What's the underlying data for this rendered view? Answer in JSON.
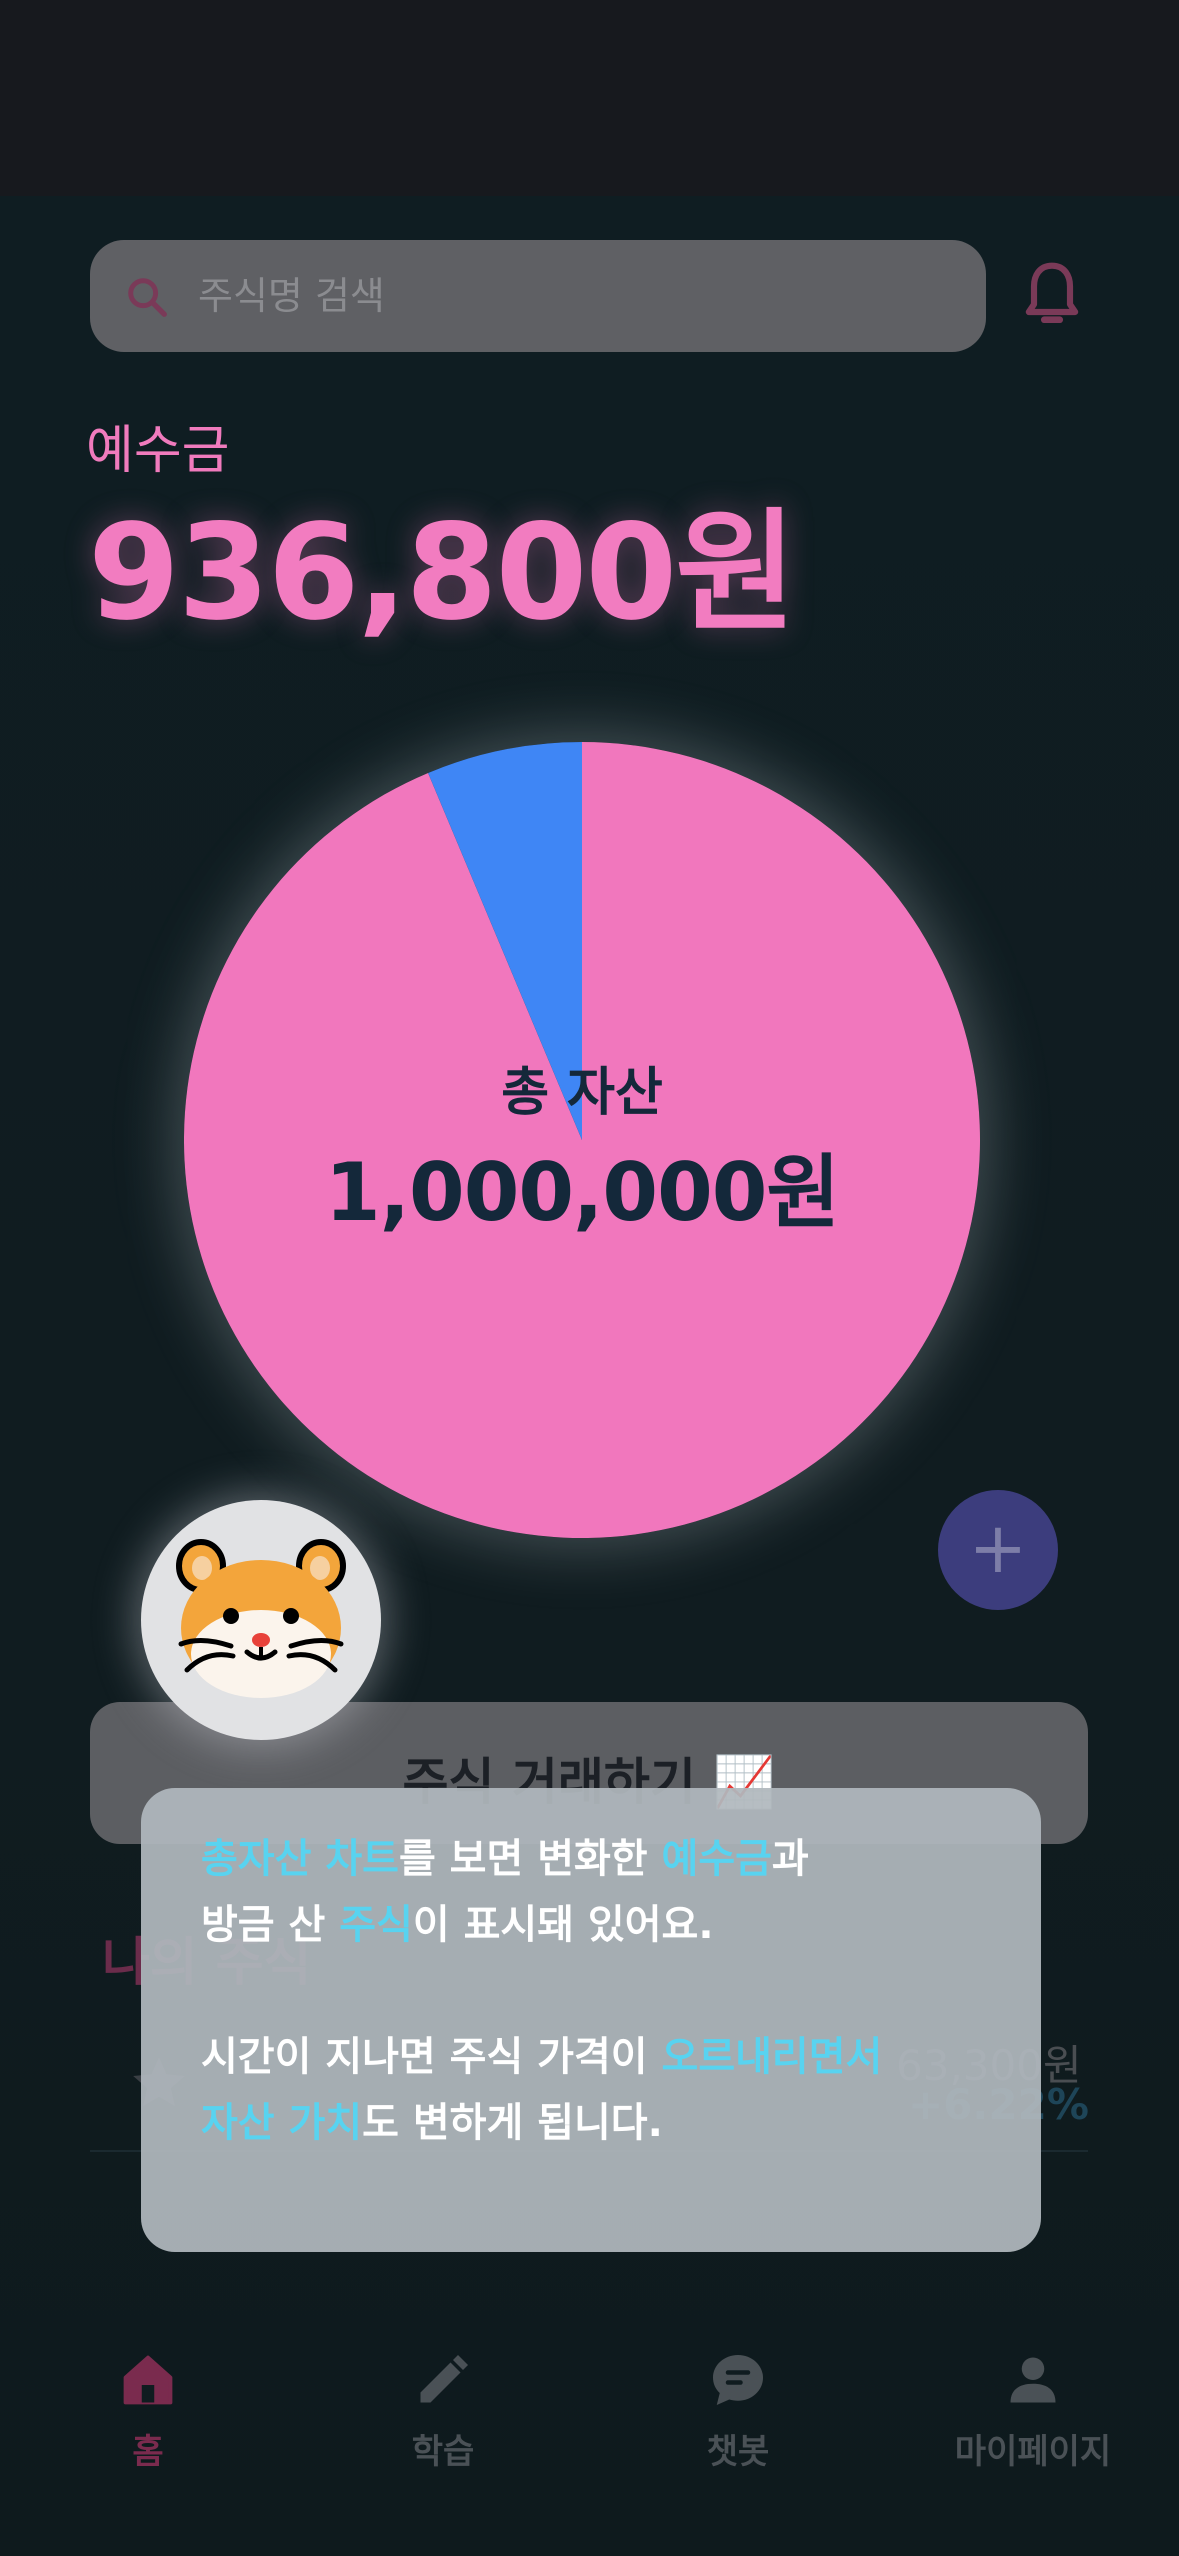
{
  "search": {
    "placeholder": "주식명 검색"
  },
  "deposit": {
    "label": "예수금",
    "amount": "936,800원"
  },
  "asset_chart": {
    "title": "총 자산",
    "total": "1,000,000원"
  },
  "chart_data": {
    "type": "pie",
    "title": "총 자산",
    "slices": [
      {
        "value": 936800,
        "color": "#f177bd"
      },
      {
        "value": 63200,
        "color": "#3f86f5"
      }
    ]
  },
  "trade_button": {
    "label": "주식 거래하기 📈"
  },
  "my_stocks": {
    "title": "나의 주식",
    "items": [
      {
        "price": "63,300원",
        "change": "+6.22%"
      }
    ]
  },
  "tooltip": {
    "line1": [
      {
        "text": "총자산 차트",
        "hl": true
      },
      {
        "text": "를 보면 변화한 ",
        "hl": false
      },
      {
        "text": "예수금",
        "hl": true
      },
      {
        "text": "과",
        "hl": false
      }
    ],
    "line2": [
      {
        "text": "방금 산 ",
        "hl": false
      },
      {
        "text": "주식",
        "hl": true
      },
      {
        "text": "이 표시돼 있어요.",
        "hl": false
      }
    ],
    "line3": [
      {
        "text": "시간이 지나면 주식 가격이 ",
        "hl": false
      },
      {
        "text": "오르내리면서",
        "hl": true
      }
    ],
    "line4": [
      {
        "text": "자산 가치",
        "hl": true
      },
      {
        "text": "도 변하게 됩니다.",
        "hl": false
      }
    ]
  },
  "nav": {
    "home": "홈",
    "learn": "학습",
    "chatbot": "챗봇",
    "mypage": "마이페이지"
  },
  "colors": {
    "accent_pink": "#f27cc0",
    "highlight_cyan": "#58d3f0",
    "pie_pink": "#f177bd",
    "pie_blue": "#3f86f5"
  }
}
